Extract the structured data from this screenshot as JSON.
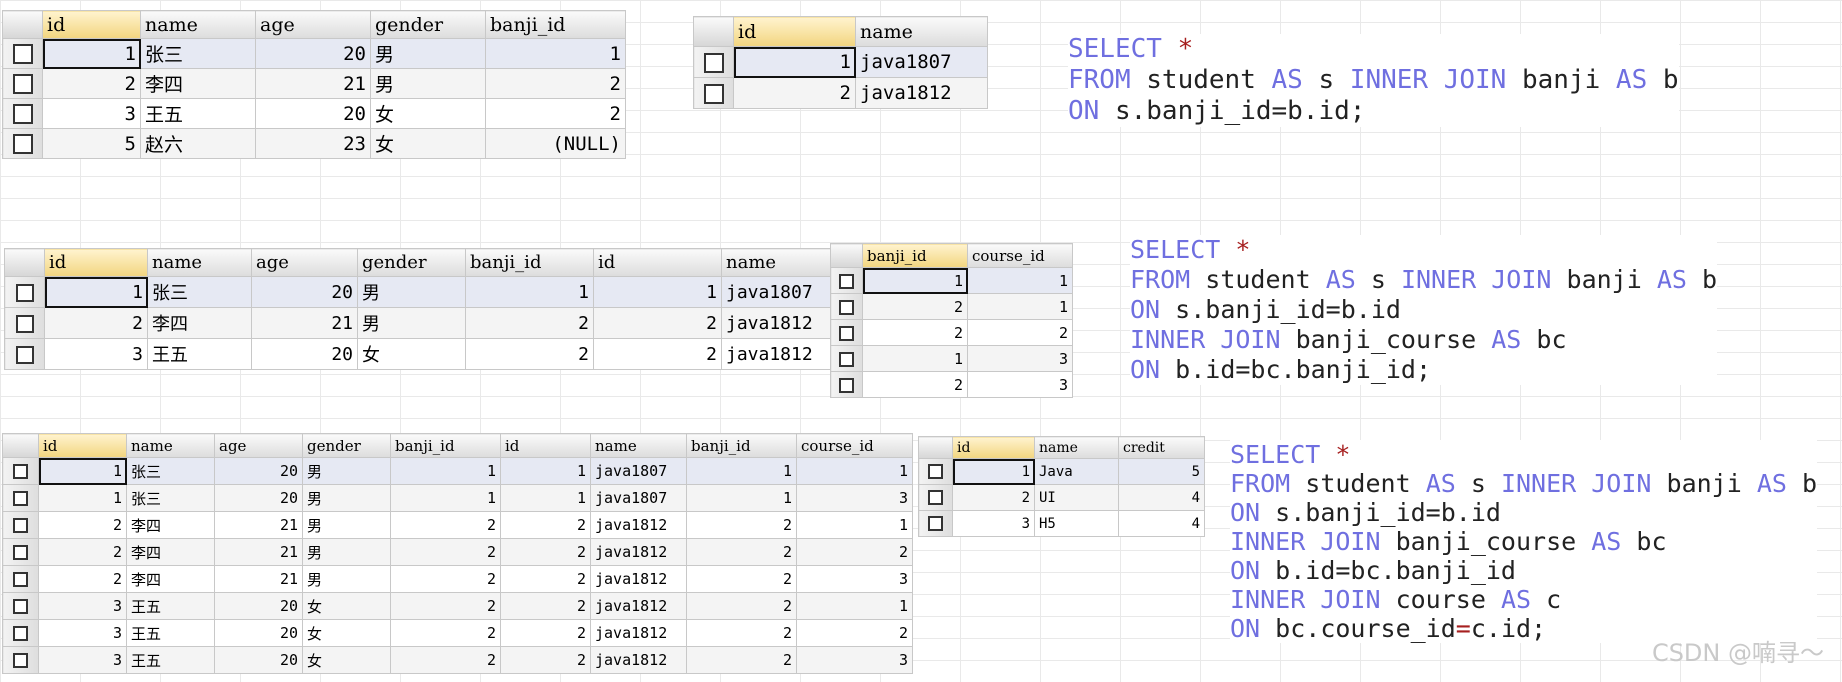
{
  "tables": {
    "student": {
      "columns": [
        "id",
        "name",
        "age",
        "gender",
        "banji_id"
      ],
      "rows": [
        [
          "1",
          "张三",
          "20",
          "男",
          "1"
        ],
        [
          "2",
          "李四",
          "21",
          "男",
          "2"
        ],
        [
          "3",
          "王五",
          "20",
          "女",
          "2"
        ],
        [
          "5",
          "赵六",
          "23",
          "女",
          "(NULL)"
        ]
      ]
    },
    "banji": {
      "columns": [
        "id",
        "name"
      ],
      "rows": [
        [
          "1",
          "java1807"
        ],
        [
          "2",
          "java1812"
        ]
      ]
    },
    "join1": {
      "columns": [
        "id",
        "name",
        "age",
        "gender",
        "banji_id",
        "id",
        "name"
      ],
      "rows": [
        [
          "1",
          "张三",
          "20",
          "男",
          "1",
          "1",
          "java1807"
        ],
        [
          "2",
          "李四",
          "21",
          "男",
          "2",
          "2",
          "java1812"
        ],
        [
          "3",
          "王五",
          "20",
          "女",
          "2",
          "2",
          "java1812"
        ]
      ]
    },
    "banji_course": {
      "columns": [
        "banji_id",
        "course_id"
      ],
      "rows": [
        [
          "1",
          "1"
        ],
        [
          "2",
          "1"
        ],
        [
          "2",
          "2"
        ],
        [
          "1",
          "3"
        ],
        [
          "2",
          "3"
        ]
      ]
    },
    "join2": {
      "columns": [
        "id",
        "name",
        "age",
        "gender",
        "banji_id",
        "id",
        "name",
        "banji_id",
        "course_id"
      ],
      "rows": [
        [
          "1",
          "张三",
          "20",
          "男",
          "1",
          "1",
          "java1807",
          "1",
          "1"
        ],
        [
          "1",
          "张三",
          "20",
          "男",
          "1",
          "1",
          "java1807",
          "1",
          "3"
        ],
        [
          "2",
          "李四",
          "21",
          "男",
          "2",
          "2",
          "java1812",
          "2",
          "1"
        ],
        [
          "2",
          "李四",
          "21",
          "男",
          "2",
          "2",
          "java1812",
          "2",
          "2"
        ],
        [
          "2",
          "李四",
          "21",
          "男",
          "2",
          "2",
          "java1812",
          "2",
          "3"
        ],
        [
          "3",
          "王五",
          "20",
          "女",
          "2",
          "2",
          "java1812",
          "2",
          "1"
        ],
        [
          "3",
          "王五",
          "20",
          "女",
          "2",
          "2",
          "java1812",
          "2",
          "2"
        ],
        [
          "3",
          "王五",
          "20",
          "女",
          "2",
          "2",
          "java1812",
          "2",
          "3"
        ]
      ]
    },
    "course": {
      "columns": [
        "id",
        "name",
        "credit"
      ],
      "rows": [
        [
          "1",
          "Java",
          "5"
        ],
        [
          "2",
          "UI",
          "4"
        ],
        [
          "3",
          "H5",
          "4"
        ]
      ]
    }
  },
  "sql1": [
    [
      [
        "kw",
        "SELECT "
      ],
      [
        "st",
        "*"
      ]
    ],
    [
      [
        "kw",
        "FROM"
      ],
      [
        "tx",
        " student "
      ],
      [
        "kw",
        "AS"
      ],
      [
        "tx",
        " s "
      ],
      [
        "kw",
        "INNER JOIN"
      ],
      [
        "tx",
        " banji "
      ],
      [
        "kw",
        "AS"
      ],
      [
        "tx",
        " b"
      ]
    ],
    [
      [
        "kw",
        "ON"
      ],
      [
        "tx",
        " s.banji_id=b.id;"
      ]
    ]
  ],
  "sql2": [
    [
      [
        "kw",
        "SELECT "
      ],
      [
        "st",
        "*"
      ]
    ],
    [
      [
        "kw",
        "FROM"
      ],
      [
        "tx",
        " student "
      ],
      [
        "kw",
        "AS"
      ],
      [
        "tx",
        " s "
      ],
      [
        "kw",
        "INNER JOIN"
      ],
      [
        "tx",
        " banji "
      ],
      [
        "kw",
        "AS"
      ],
      [
        "tx",
        " b"
      ]
    ],
    [
      [
        "kw",
        "ON"
      ],
      [
        "tx",
        " s.banji_id=b.id"
      ]
    ],
    [
      [
        "kw",
        "INNER JOIN"
      ],
      [
        "tx",
        " banji_course "
      ],
      [
        "kw",
        "AS"
      ],
      [
        "tx",
        " bc"
      ]
    ],
    [
      [
        "kw",
        "ON"
      ],
      [
        "tx",
        " b.id=bc.banji_id;"
      ]
    ]
  ],
  "sql3": [
    [
      [
        "kw",
        "SELECT "
      ],
      [
        "st",
        "*"
      ]
    ],
    [
      [
        "kw",
        "FROM"
      ],
      [
        "tx",
        " student "
      ],
      [
        "kw",
        "AS"
      ],
      [
        "tx",
        " s "
      ],
      [
        "kw",
        "INNER JOIN"
      ],
      [
        "tx",
        " banji "
      ],
      [
        "kw",
        "AS"
      ],
      [
        "tx",
        " b"
      ]
    ],
    [
      [
        "kw",
        "ON"
      ],
      [
        "tx",
        " s.banji_id=b.id"
      ]
    ],
    [
      [
        "kw",
        "INNER JOIN"
      ],
      [
        "tx",
        " banji_course "
      ],
      [
        "kw",
        "AS"
      ],
      [
        "tx",
        " bc"
      ]
    ],
    [
      [
        "kw",
        "ON"
      ],
      [
        "tx",
        " b.id=bc.banji_id"
      ]
    ],
    [
      [
        "kw",
        "INNER JOIN"
      ],
      [
        "tx",
        " course "
      ],
      [
        "kw",
        "AS"
      ],
      [
        "tx",
        " c"
      ]
    ],
    [
      [
        "kw",
        "ON"
      ],
      [
        "tx",
        " bc.course_id"
      ],
      [
        "st",
        "="
      ],
      [
        "tx",
        "c.id;"
      ]
    ]
  ],
  "watermark": "CSDN @喃寻～",
  "colors": {
    "keyword": "#6f6fe0",
    "star": "#a61f1f",
    "header_selected": "#f2d57f"
  }
}
